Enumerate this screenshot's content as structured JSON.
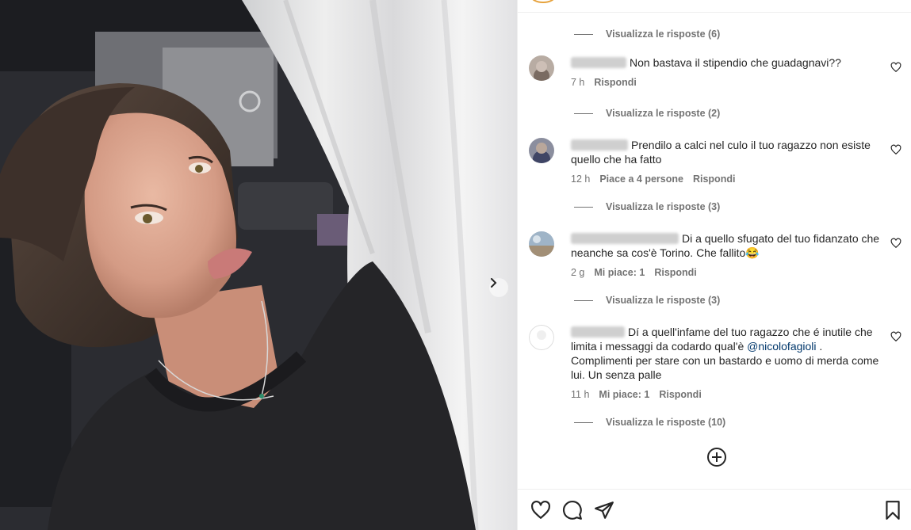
{
  "photo": {
    "next_icon": "chevron-right-icon"
  },
  "comments": [
    {
      "text": "Non bastava il stipendio che guadagnavi??",
      "time": "7 h",
      "likes": "",
      "reply": "Rispondi",
      "view_replies": "Visualizza le risposte (2)"
    },
    {
      "text": "Prendilo a calci nel culo il tuo ragazzo non esiste quello che ha fatto",
      "time": "12 h",
      "likes": "Piace a 4 persone",
      "reply": "Rispondi",
      "view_replies": "Visualizza le risposte (3)"
    },
    {
      "text": "Di a quello sfugato del tuo fidanzato che neanche sa cos'è Torino. Che fallito",
      "emoji": "😂",
      "time": "2 g",
      "likes": "Mi piace: 1",
      "reply": "Rispondi",
      "view_replies": "Visualizza le risposte (3)"
    },
    {
      "text_before": "Dí a quell'infame del tuo ragazzo che é inutile che limita i messaggi da codardo qual'è ",
      "mention": "@nicolofagioli",
      "text_after": " . Complimenti per stare con un bastardo e uomo di merda come lui. Un senza palle",
      "time": "11 h",
      "likes": "Mi piace: 1",
      "reply": "Rispondi",
      "view_replies": "Visualizza le risposte (10)"
    }
  ],
  "top_view_replies": "Visualizza le risposte (6)",
  "icons": {
    "add": "plus-circle-icon",
    "like": "heart-icon",
    "comment": "comment-icon",
    "share": "send-icon",
    "save": "bookmark-icon"
  },
  "colors": {
    "text": "#262626",
    "secondary": "#737373",
    "mention": "#00376b",
    "divider": "#efefef"
  }
}
